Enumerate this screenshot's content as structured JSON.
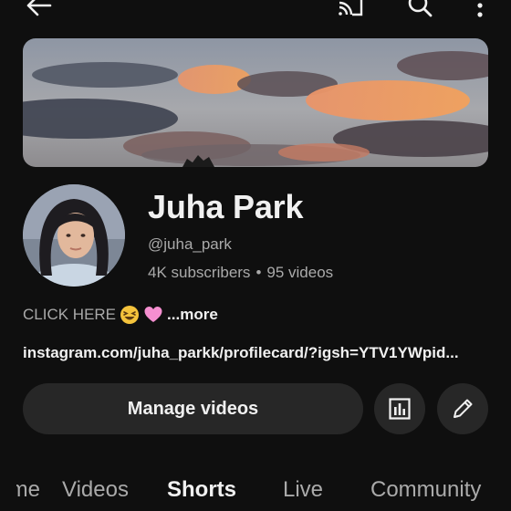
{
  "colors": {
    "background": "#0f0f0f",
    "button_bg": "#272727",
    "text_primary": "#f1f1f1",
    "text_secondary": "#aaaaaa"
  },
  "topbar": {
    "icons": [
      "back-arrow-icon",
      "cast-icon",
      "search-icon",
      "more-vert-icon"
    ]
  },
  "channel": {
    "name": "Juha Park",
    "handle": "@juha_park",
    "subscribers": "4K subscribers",
    "separator": "•",
    "videos": "95 videos"
  },
  "description": {
    "text": "CLICK HERE",
    "emojis": [
      "grinning-squinting-face-icon",
      "pink-heart-icon"
    ],
    "more_label": "...more"
  },
  "link": {
    "text": "instagram.com/juha_parkk/profilecard/?igsh=YTV1YWpid..."
  },
  "actions": {
    "manage_label": "Manage videos",
    "analytics_icon": "analytics-icon",
    "edit_icon": "pencil-icon"
  },
  "tabs": [
    {
      "label": "Home",
      "active": false
    },
    {
      "label": "Videos",
      "active": false
    },
    {
      "label": "Shorts",
      "active": true
    },
    {
      "label": "Live",
      "active": false
    },
    {
      "label": "Community",
      "active": false
    }
  ]
}
